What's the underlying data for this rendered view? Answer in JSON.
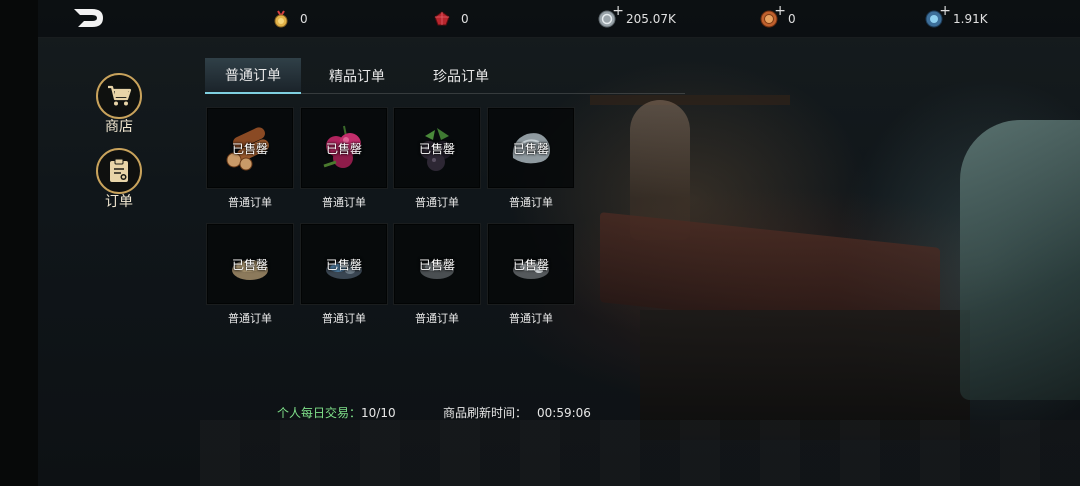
{
  "resources": [
    {
      "icon": "gold-medal-icon",
      "value": "0",
      "has_plus": false
    },
    {
      "icon": "red-gem-icon",
      "value": "0",
      "has_plus": false
    },
    {
      "icon": "silver-coin-icon",
      "value": "205.07K",
      "has_plus": true
    },
    {
      "icon": "bronze-coin-icon",
      "value": "0",
      "has_plus": true
    },
    {
      "icon": "blue-crystal-icon",
      "value": "1.91K",
      "has_plus": true
    }
  ],
  "plus_symbol": "+",
  "sidebar": {
    "shop_label": "商店",
    "orders_label": "订单"
  },
  "tabs": [
    {
      "label": "普通订单",
      "active": true
    },
    {
      "label": "精品订单",
      "active": false
    },
    {
      "label": "珍品订单",
      "active": false
    }
  ],
  "orders": [
    {
      "item_icon": "wood-logs-icon",
      "status": "已售罄",
      "label": "普通订单"
    },
    {
      "item_icon": "purple-berries-icon",
      "status": "已售罄",
      "label": "普通订单"
    },
    {
      "item_icon": "blackberries-icon",
      "status": "已售罄",
      "label": "普通订单"
    },
    {
      "item_icon": "stone-ore-icon",
      "status": "已售罄",
      "label": "普通订单"
    },
    {
      "item_icon": "sandstone-icon",
      "status": "已售罄",
      "label": "普通订单"
    },
    {
      "item_icon": "blue-ore-icon",
      "status": "已售罄",
      "label": "普通订单"
    },
    {
      "item_icon": "gray-ore-icon",
      "status": "已售罄",
      "label": "普通订单"
    },
    {
      "item_icon": "silver-ore-icon",
      "status": "已售罄",
      "label": "普通订单"
    }
  ],
  "footer": {
    "daily_trade_label": "个人每日交易：",
    "daily_trade_value": "10/10",
    "refresh_label": "商品刷新时间：",
    "refresh_value": "00:59:06"
  },
  "colors": {
    "accent_tab": "#7fd0e0",
    "gold_ring": "#c9a35c",
    "daily_trade_green": "#7fe08a"
  }
}
